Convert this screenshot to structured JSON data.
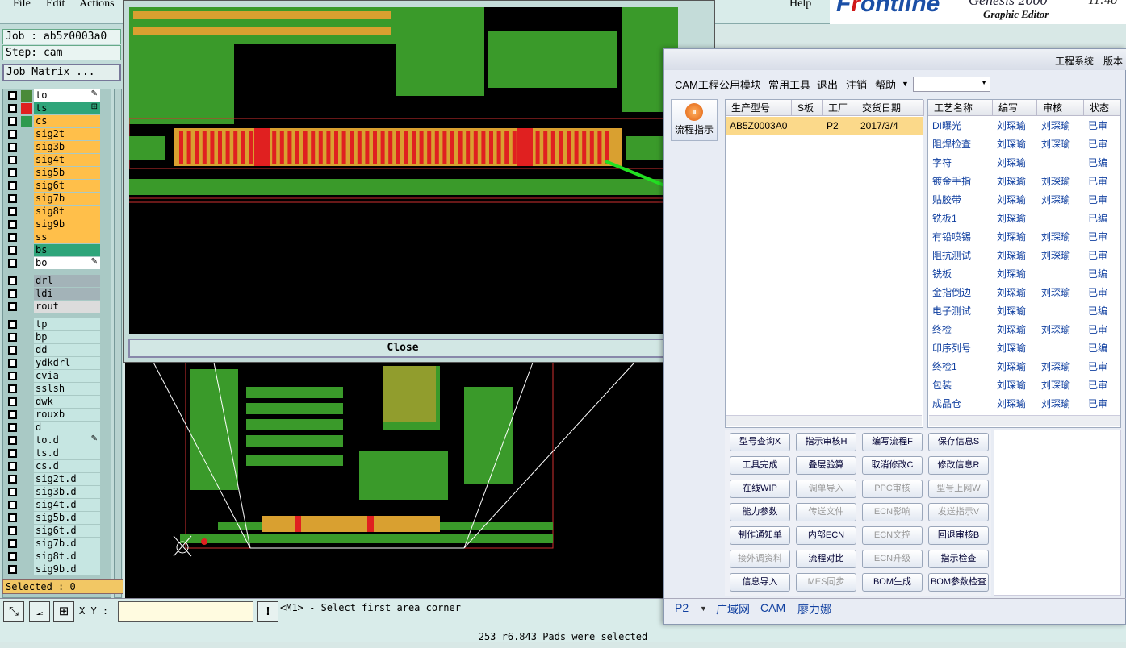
{
  "menubar": {
    "file": "File",
    "edit": "Edit",
    "actions": "Actions",
    "help": "Help"
  },
  "brand": {
    "logo_pre": "F",
    "logo_hl": "r",
    "logo_post": "ontline",
    "product": "Genesis 2000",
    "subtitle": "Graphic Editor",
    "clock": "11:40"
  },
  "left": {
    "job": "Job : ab5z0003a0",
    "step": "Step: cam",
    "matrix_button": "Job Matrix ...",
    "layers": [
      {
        "name": "to",
        "color": "#ffffff",
        "sq": "#4a8a3a",
        "mark": "✎"
      },
      {
        "name": "ts",
        "color": "#2fa57a",
        "sq": "#e02020",
        "mark": "⊞"
      },
      {
        "name": "cs",
        "color": "#ffbf4a",
        "sq": "#2e9a4e",
        "mark": ""
      },
      {
        "name": "sig2t",
        "color": "#ffbf4a",
        "sq": "",
        "mark": ""
      },
      {
        "name": "sig3b",
        "color": "#ffbf4a",
        "sq": "",
        "mark": ""
      },
      {
        "name": "sig4t",
        "color": "#ffbf4a",
        "sq": "",
        "mark": ""
      },
      {
        "name": "sig5b",
        "color": "#ffbf4a",
        "sq": "",
        "mark": ""
      },
      {
        "name": "sig6t",
        "color": "#ffbf4a",
        "sq": "",
        "mark": ""
      },
      {
        "name": "sig7b",
        "color": "#ffbf4a",
        "sq": "",
        "mark": ""
      },
      {
        "name": "sig8t",
        "color": "#ffbf4a",
        "sq": "",
        "mark": ""
      },
      {
        "name": "sig9b",
        "color": "#ffbf4a",
        "sq": "",
        "mark": ""
      },
      {
        "name": "ss",
        "color": "#ffbf4a",
        "sq": "",
        "mark": ""
      },
      {
        "name": "bs",
        "color": "#2fa57a",
        "sq": "",
        "mark": ""
      },
      {
        "name": "bo",
        "color": "#ffffff",
        "sq": "",
        "mark": "✎"
      },
      {
        "name": "",
        "color": "",
        "sq": "",
        "mark": ""
      },
      {
        "name": "drl",
        "color": "#a3b3b8",
        "sq": "",
        "mark": ""
      },
      {
        "name": "ldi",
        "color": "#a3b3b8",
        "sq": "",
        "mark": ""
      },
      {
        "name": "rout",
        "color": "#dcdcdc",
        "sq": "",
        "mark": ""
      },
      {
        "name": "",
        "color": "",
        "sq": "",
        "mark": ""
      },
      {
        "name": "tp",
        "color": "#c6e6e2",
        "sq": "",
        "mark": ""
      },
      {
        "name": "bp",
        "color": "#c6e6e2",
        "sq": "",
        "mark": ""
      },
      {
        "name": "dd",
        "color": "#c6e6e2",
        "sq": "",
        "mark": ""
      },
      {
        "name": "ydkdrl",
        "color": "#c6e6e2",
        "sq": "",
        "mark": ""
      },
      {
        "name": "cvia",
        "color": "#c6e6e2",
        "sq": "",
        "mark": ""
      },
      {
        "name": "sslsh",
        "color": "#c6e6e2",
        "sq": "",
        "mark": ""
      },
      {
        "name": "dwk",
        "color": "#c6e6e2",
        "sq": "",
        "mark": ""
      },
      {
        "name": "rouxb",
        "color": "#c6e6e2",
        "sq": "",
        "mark": ""
      },
      {
        "name": "d",
        "color": "#c6e6e2",
        "sq": "",
        "mark": ""
      },
      {
        "name": "to.d",
        "color": "#c6e6e2",
        "sq": "",
        "mark": "✎"
      },
      {
        "name": "ts.d",
        "color": "#c6e6e2",
        "sq": "",
        "mark": ""
      },
      {
        "name": "cs.d",
        "color": "#c6e6e2",
        "sq": "",
        "mark": ""
      },
      {
        "name": "sig2t.d",
        "color": "#c6e6e2",
        "sq": "",
        "mark": ""
      },
      {
        "name": "sig3b.d",
        "color": "#c6e6e2",
        "sq": "",
        "mark": ""
      },
      {
        "name": "sig4t.d",
        "color": "#c6e6e2",
        "sq": "",
        "mark": ""
      },
      {
        "name": "sig5b.d",
        "color": "#c6e6e2",
        "sq": "",
        "mark": ""
      },
      {
        "name": "sig6t.d",
        "color": "#c6e6e2",
        "sq": "",
        "mark": ""
      },
      {
        "name": "sig7b.d",
        "color": "#c6e6e2",
        "sq": "",
        "mark": ""
      },
      {
        "name": "sig8t.d",
        "color": "#c6e6e2",
        "sq": "",
        "mark": ""
      },
      {
        "name": "sig9b.d",
        "color": "#c6e6e2",
        "sq": "",
        "mark": ""
      }
    ],
    "selected": "Selected : 0"
  },
  "bottom": {
    "xy_label": "X Y :",
    "message": "<M1> - Select first area corner",
    "status": "253 r6.843 Pads were selected"
  },
  "zoom": {
    "close": "Close"
  },
  "cam": {
    "title_items": [
      "工程系统",
      "版本"
    ],
    "menu": [
      "CAM工程",
      "公用模块",
      "常用工具",
      "退出",
      "注销",
      "帮助"
    ],
    "flow_button": "流程指示",
    "table1": {
      "headers": [
        "生产型号",
        "S板",
        "工厂",
        "交货日期"
      ],
      "rows": [
        [
          "AB5Z0003A0",
          "",
          "P2",
          "2017/3/4"
        ]
      ]
    },
    "table2": {
      "headers": [
        "工艺名称",
        "编写",
        "审核",
        "状态"
      ],
      "rows": [
        [
          "DI曝光",
          "刘琛瑜",
          "刘琛瑜",
          "已审"
        ],
        [
          "阻焊检查",
          "刘琛瑜",
          "刘琛瑜",
          "已审"
        ],
        [
          "字符",
          "刘琛瑜",
          "",
          "已编"
        ],
        [
          "镀金手指",
          "刘琛瑜",
          "刘琛瑜",
          "已审"
        ],
        [
          "贴胶带",
          "刘琛瑜",
          "刘琛瑜",
          "已审"
        ],
        [
          "铣板1",
          "刘琛瑜",
          "",
          "已编"
        ],
        [
          "有铅喷锡",
          "刘琛瑜",
          "刘琛瑜",
          "已审"
        ],
        [
          "阻抗测试",
          "刘琛瑜",
          "刘琛瑜",
          "已审"
        ],
        [
          "铣板",
          "刘琛瑜",
          "",
          "已编"
        ],
        [
          "金指倒边",
          "刘琛瑜",
          "刘琛瑜",
          "已审"
        ],
        [
          "电子测试",
          "刘琛瑜",
          "",
          "已编"
        ],
        [
          "终检",
          "刘琛瑜",
          "刘琛瑜",
          "已审"
        ],
        [
          "印序列号",
          "刘琛瑜",
          "",
          "已编"
        ],
        [
          "终检1",
          "刘琛瑜",
          "刘琛瑜",
          "已审"
        ],
        [
          "包装",
          "刘琛瑜",
          "刘琛瑜",
          "已审"
        ],
        [
          "成品仓",
          "刘琛瑜",
          "刘琛瑜",
          "已审"
        ]
      ]
    },
    "buttons": [
      [
        "型号查询X",
        "指示审核H",
        "编写流程F",
        "保存信息S"
      ],
      [
        "工具完成",
        "叠层验算",
        "取消修改C",
        "修改信息R"
      ],
      [
        "在线WIP",
        "调单导入",
        "PPC审核",
        "型号上网W"
      ],
      [
        "能力参数",
        "传送文件",
        "ECN影响",
        "发送指示V"
      ],
      [
        "制作通知单",
        "内部ECN",
        "ECN文控",
        "回退审核B"
      ],
      [
        "接外调资料",
        "流程对比",
        "ECN升级",
        "指示检查"
      ],
      [
        "信息导入",
        "MES同步",
        "BOM生成",
        "BOM参数检查"
      ]
    ],
    "disabled": [
      "调单导入",
      "PPC审核",
      "型号上网W",
      "传送文件",
      "ECN影响",
      "发送指示V",
      "ECN文控",
      "接外调资料",
      "ECN升级",
      "MES同步"
    ],
    "status": [
      "P2",
      "广域网",
      "CAM",
      "廖力娜"
    ]
  }
}
